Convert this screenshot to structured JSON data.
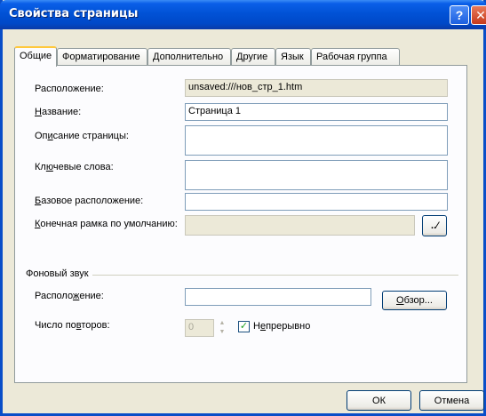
{
  "window": {
    "title": "Свойства страницы"
  },
  "titlebar_buttons": {
    "help": "?",
    "close": "✕"
  },
  "tabs": [
    {
      "label": "Общие"
    },
    {
      "label": "Форматирование"
    },
    {
      "label": "Дополнительно"
    },
    {
      "label": "Другие"
    },
    {
      "label": "Язык"
    },
    {
      "label": "Рабочая группа"
    }
  ],
  "general": {
    "location_label": "Расположение:",
    "location_value": "unsaved:///нов_стр_1.htm",
    "title_label_pre": "",
    "title_label_key": "Н",
    "title_label_post": "азвание:",
    "title_value": "Страница 1",
    "description_label_pre": "Оп",
    "description_label_key": "и",
    "description_label_post": "сание страницы:",
    "description_value": "",
    "keywords_label_pre": "Кл",
    "keywords_label_key": "ю",
    "keywords_label_post": "чевые слова:",
    "keywords_value": "",
    "base_label_pre": "",
    "base_label_key": "Б",
    "base_label_post": "азовое расположение:",
    "base_value": "",
    "target_label_pre": "",
    "target_label_key": "К",
    "target_label_post": "онечная рамка по умолчанию:",
    "target_value": "",
    "target_button": "..⁄"
  },
  "background_sound": {
    "group_label": "Фоновый звук",
    "location_label_pre": "Располо",
    "location_label_key": "ж",
    "location_label_post": "ение:",
    "location_value": "",
    "browse_label_pre": "",
    "browse_label_key": "О",
    "browse_label_post": "бзор...",
    "loop_label_pre": "Число по",
    "loop_label_key": "в",
    "loop_label_post": "торов:",
    "loop_value": "0",
    "continuous_checked": true,
    "continuous_label_pre": "Н",
    "continuous_label_key": "е",
    "continuous_label_post": "прерывно"
  },
  "footer": {
    "ok_label": "ОК",
    "cancel_label": "Отмена"
  }
}
